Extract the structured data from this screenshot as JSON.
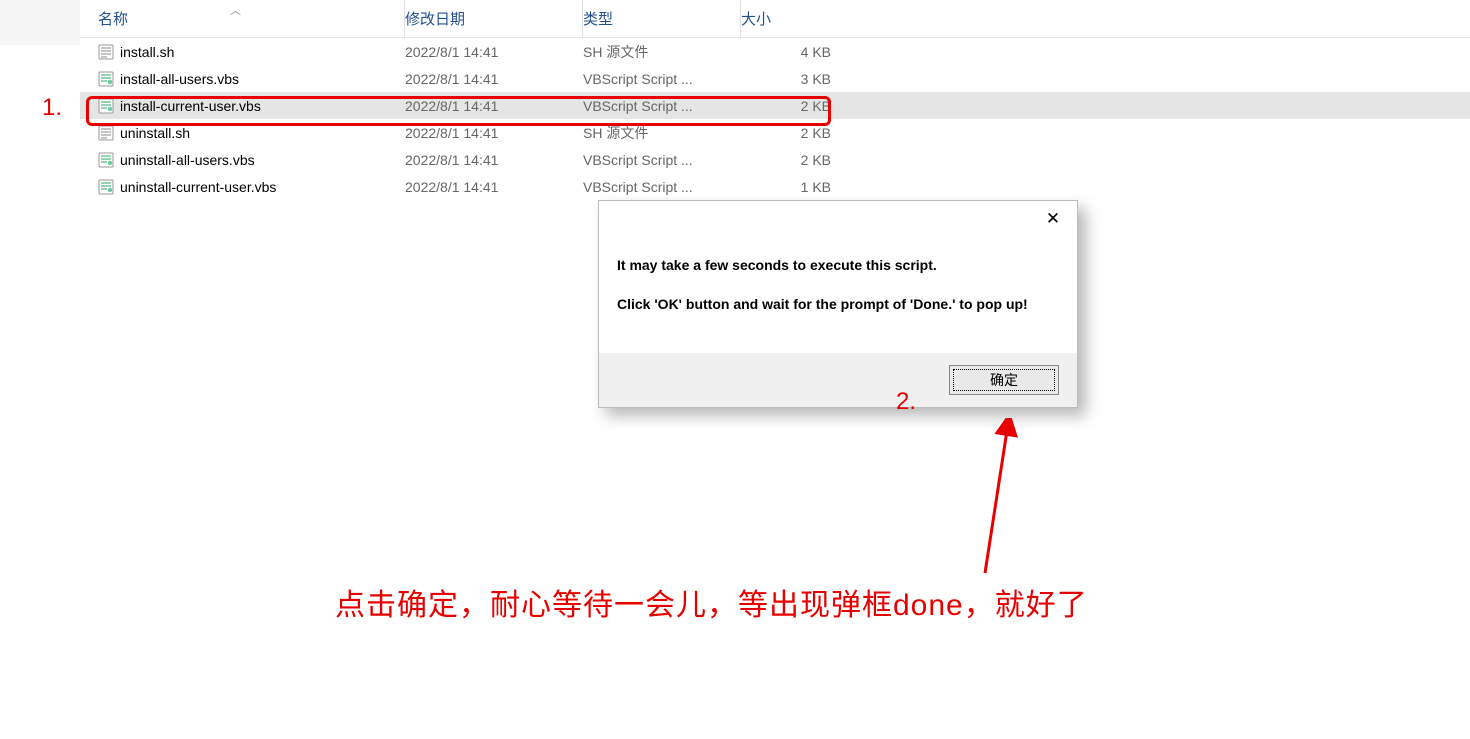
{
  "columns": {
    "name": "名称",
    "date": "修改日期",
    "type": "类型",
    "size": "大小"
  },
  "files": [
    {
      "name": "install.sh",
      "date": "2022/8/1 14:41",
      "type": "SH 源文件",
      "size": "4 KB",
      "icon": "sh"
    },
    {
      "name": "install-all-users.vbs",
      "date": "2022/8/1 14:41",
      "type": "VBScript Script ...",
      "size": "3 KB",
      "icon": "vbs"
    },
    {
      "name": "install-current-user.vbs",
      "date": "2022/8/1 14:41",
      "type": "VBScript Script ...",
      "size": "2 KB",
      "icon": "vbs",
      "selected": true
    },
    {
      "name": "uninstall.sh",
      "date": "2022/8/1 14:41",
      "type": "SH 源文件",
      "size": "2 KB",
      "icon": "sh"
    },
    {
      "name": "uninstall-all-users.vbs",
      "date": "2022/8/1 14:41",
      "type": "VBScript Script ...",
      "size": "2 KB",
      "icon": "vbs"
    },
    {
      "name": "uninstall-current-user.vbs",
      "date": "2022/8/1 14:41",
      "type": "VBScript Script ...",
      "size": "1 KB",
      "icon": "vbs"
    }
  ],
  "dialog": {
    "line1": "It may take a few seconds to execute this script.",
    "line2": "Click 'OK' button and wait for the prompt of 'Done.' to pop up!",
    "ok_label": "确定"
  },
  "annotations": {
    "label1": "1.",
    "label2": "2.",
    "caption": "点击确定，耐心等待一会儿，等出现弹框done，就好了"
  }
}
